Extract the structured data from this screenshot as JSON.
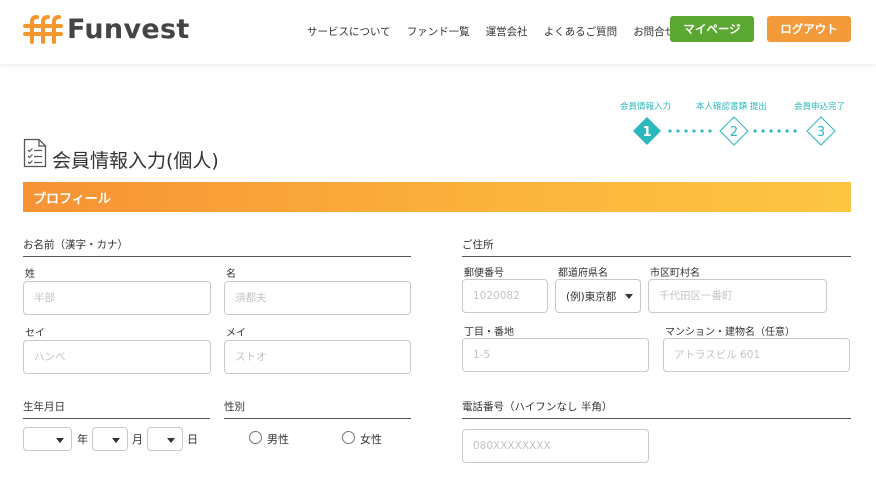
{
  "header": {
    "logo_text": "Funvest",
    "nav": [
      "サービスについて",
      "ファンド一覧",
      "運営会社",
      "よくあるご質問",
      "お問合せ"
    ],
    "mypage_label": "マイページ",
    "logout_label": "ログアウト"
  },
  "steps": {
    "items": [
      {
        "label": "会員情報入力",
        "number": "1",
        "active": true
      },
      {
        "label": "本人確認書類 提出",
        "number": "2",
        "active": false
      },
      {
        "label": "会員申込完了",
        "number": "3",
        "active": false
      }
    ],
    "accent_color": "#2cb8bc"
  },
  "page_title": "会員情報入力(個人)",
  "section_title": "プロフィール",
  "name_section": {
    "heading": "お名前（漢字・カナ）",
    "sei_label": "姓",
    "sei_placeholder": "半部",
    "mei_label": "名",
    "mei_placeholder": "須都夫",
    "sei_kana_label": "セイ",
    "sei_kana_placeholder": "ハンベ",
    "mei_kana_label": "メイ",
    "mei_kana_placeholder": "ストオ"
  },
  "birth_section": {
    "heading": "生年月日",
    "year_unit": "年",
    "month_unit": "月",
    "day_unit": "日"
  },
  "gender_section": {
    "heading": "性別",
    "options": [
      "男性",
      "女性"
    ]
  },
  "address_section": {
    "heading": "ご住所",
    "postal_label": "郵便番号",
    "postal_placeholder": "1020082",
    "prefecture_label": "都道府県名",
    "prefecture_value": "(例)東京都",
    "city_label": "市区町村名",
    "city_placeholder": "千代田区一番町",
    "street_label": "丁目・番地",
    "street_placeholder": "1-5",
    "building_label": "マンション・建物名（任意）",
    "building_placeholder": "アトラスビル 601"
  },
  "phone_section": {
    "heading": "電話番号（ハイフンなし 半角）",
    "placeholder": "080XXXXXXXX"
  },
  "colors": {
    "mypage": "#5aa832",
    "logout": "#f39a3a",
    "banner_start": "#f79235",
    "banner_end": "#fcc642"
  }
}
